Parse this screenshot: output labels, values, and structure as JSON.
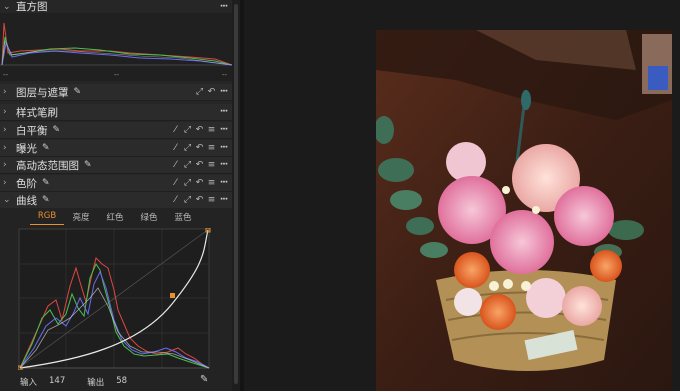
{
  "panels": {
    "histogram": {
      "title": "直方图",
      "ticks": [
        "--",
        "--",
        "--"
      ]
    },
    "layers": {
      "title": "图层与遮罩"
    },
    "style_brush": {
      "title": "样式笔刷"
    },
    "white_balance": {
      "title": "白平衡"
    },
    "exposure": {
      "title": "曝光"
    },
    "hdr": {
      "title": "高动态范围图"
    },
    "levels": {
      "title": "色阶"
    },
    "curves": {
      "title": "曲线"
    }
  },
  "curves": {
    "tabs": [
      "RGB",
      "亮度",
      "红色",
      "绿色",
      "蓝色"
    ],
    "active_tab": "RGB",
    "input_label": "输入",
    "input_value": "147",
    "output_label": "输出",
    "output_value": "58"
  },
  "colors": {
    "accent": "#e8912a",
    "red_channel": "#e0463f",
    "green_channel": "#48c24f",
    "blue_channel": "#6a6cf0"
  }
}
